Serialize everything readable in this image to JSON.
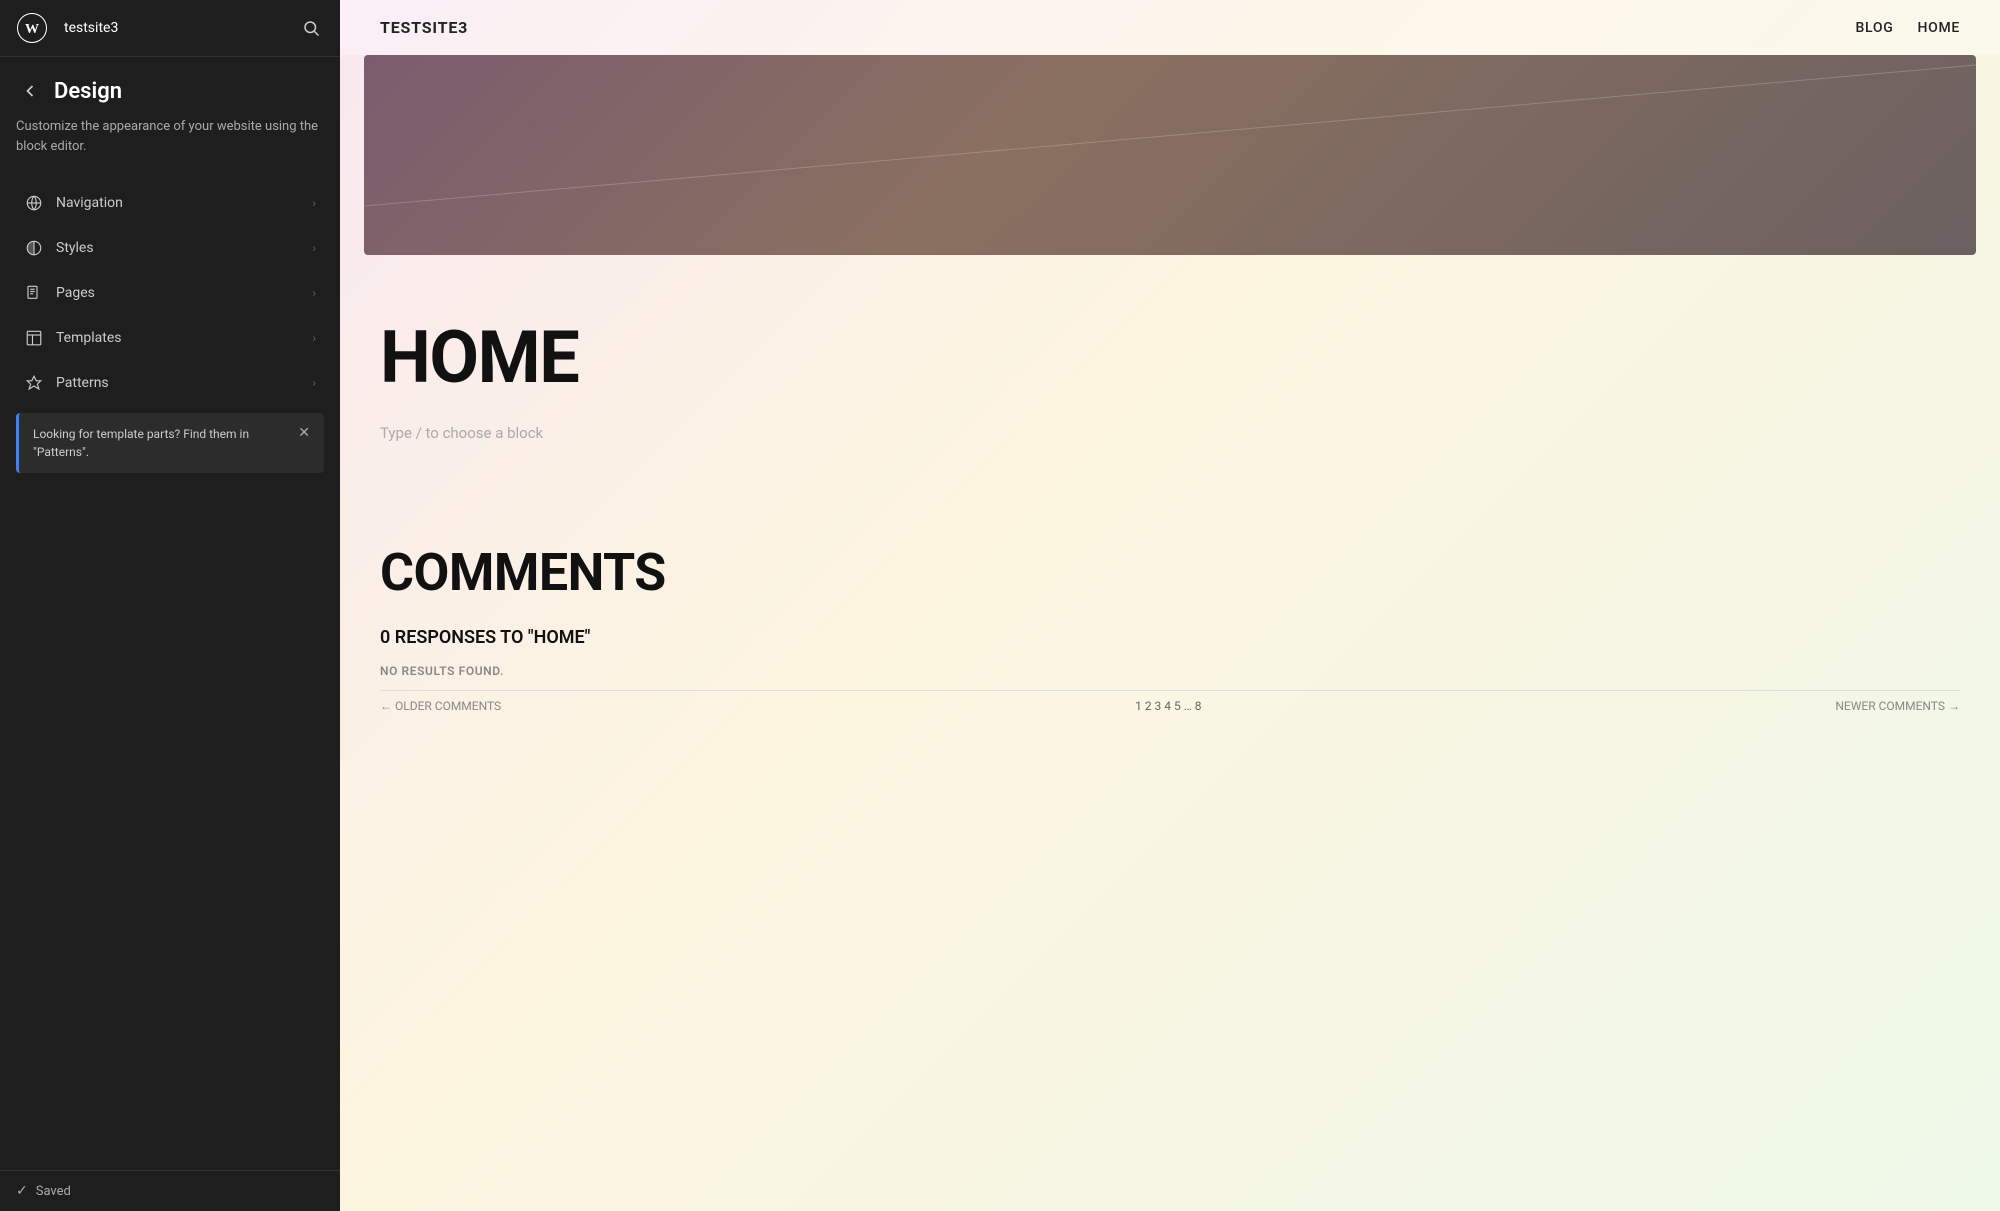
{
  "topbar": {
    "site_name": "testsite3",
    "search_aria": "Search"
  },
  "sidebar": {
    "back_aria": "Back",
    "title": "Design",
    "description": "Customize the appearance of your website using the block editor.",
    "nav_items": [
      {
        "id": "navigation",
        "label": "Navigation",
        "icon": "navigation-icon"
      },
      {
        "id": "styles",
        "label": "Styles",
        "icon": "styles-icon"
      },
      {
        "id": "pages",
        "label": "Pages",
        "icon": "pages-icon"
      },
      {
        "id": "templates",
        "label": "Templates",
        "icon": "templates-icon"
      },
      {
        "id": "patterns",
        "label": "Patterns",
        "icon": "patterns-icon"
      }
    ],
    "info_banner": {
      "text": "Looking for template parts? Find them in \"Patterns\".",
      "close_aria": "Close"
    },
    "footer": {
      "saved_label": "Saved"
    }
  },
  "preview": {
    "site_logo": "TESTSITE3",
    "nav_links": [
      {
        "label": "BLOG"
      },
      {
        "label": "HOME"
      }
    ],
    "page_title": "HOME",
    "block_placeholder": "Type / to choose a block",
    "comments_title": "COMMENTS",
    "responses_title": "0 RESPONSES TO \"HOME\"",
    "no_results": "NO RESULTS FOUND.",
    "pagination": {
      "older": "← OLDER COMMENTS",
      "numbers": "1 2 3 4 5 … 8",
      "newer": "NEWER COMMENTS →"
    }
  }
}
